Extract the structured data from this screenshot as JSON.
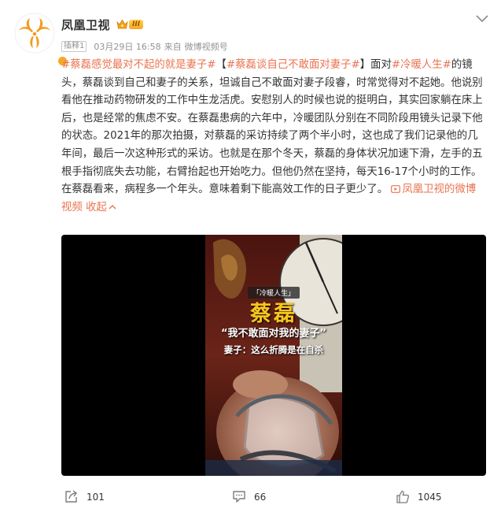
{
  "author": {
    "name": "凤凰卫视",
    "vip_level": "III"
  },
  "meta": {
    "tag": "插释1",
    "time": "03月29日 16:58",
    "source_prefix": "来自",
    "source": "微博视频号"
  },
  "post": {
    "seg1": "#蔡磊感觉最对不起的就是妻子#",
    "seg2": "【",
    "seg3": "#蔡磊谈自己不敢面对妻子#",
    "seg4": "】面对",
    "seg5": "#冷暖人生#",
    "seg6": "的镜头，蔡磊谈到自己和妻子的关系，坦诚自己不敢面对妻子段睿，时常觉得对不起她。他说别看他在推动药物研发的工作中生龙活虎。安慰别人的时候也说的挺明白，其实回家躺在床上后，也是经常的焦虑不安。在蔡磊患病的六年中，冷暖团队分别在不同阶段用镜头记录下他的状态。2021年的那次拍摄，对蔡磊的采访持续了两个半小时，这也成了我们记录他的几年间，最后一次这种形式的采访。也就是在那个冬天，蔡磊的身体状况加速下滑，左手的五根手指彻底失去功能，右臂抬起也开始吃力。但他仍然在坚持，每天16-17个小时的工作。在蔡磊看来，病程多一个年头。意味着剩下能高效工作的日子更少了。",
    "source_link": "凤凰卫视的微博视频",
    "collapse": "收起"
  },
  "video": {
    "tag": "「冷暖人生」",
    "name": "蔡磊",
    "quote": "“我不敢面对我的妻子”",
    "sub": "妻子：这么折腾是在自杀"
  },
  "actions": {
    "repost_count": "101",
    "comment_count": "66",
    "like_count": "1045"
  },
  "colors": {
    "accent": "#eb7350",
    "text": "#333333",
    "meta": "#939393"
  },
  "icons": {
    "menu": "chevron-down-icon",
    "repost": "share-icon",
    "comment": "comment-icon",
    "like": "thumbs-up-icon"
  }
}
